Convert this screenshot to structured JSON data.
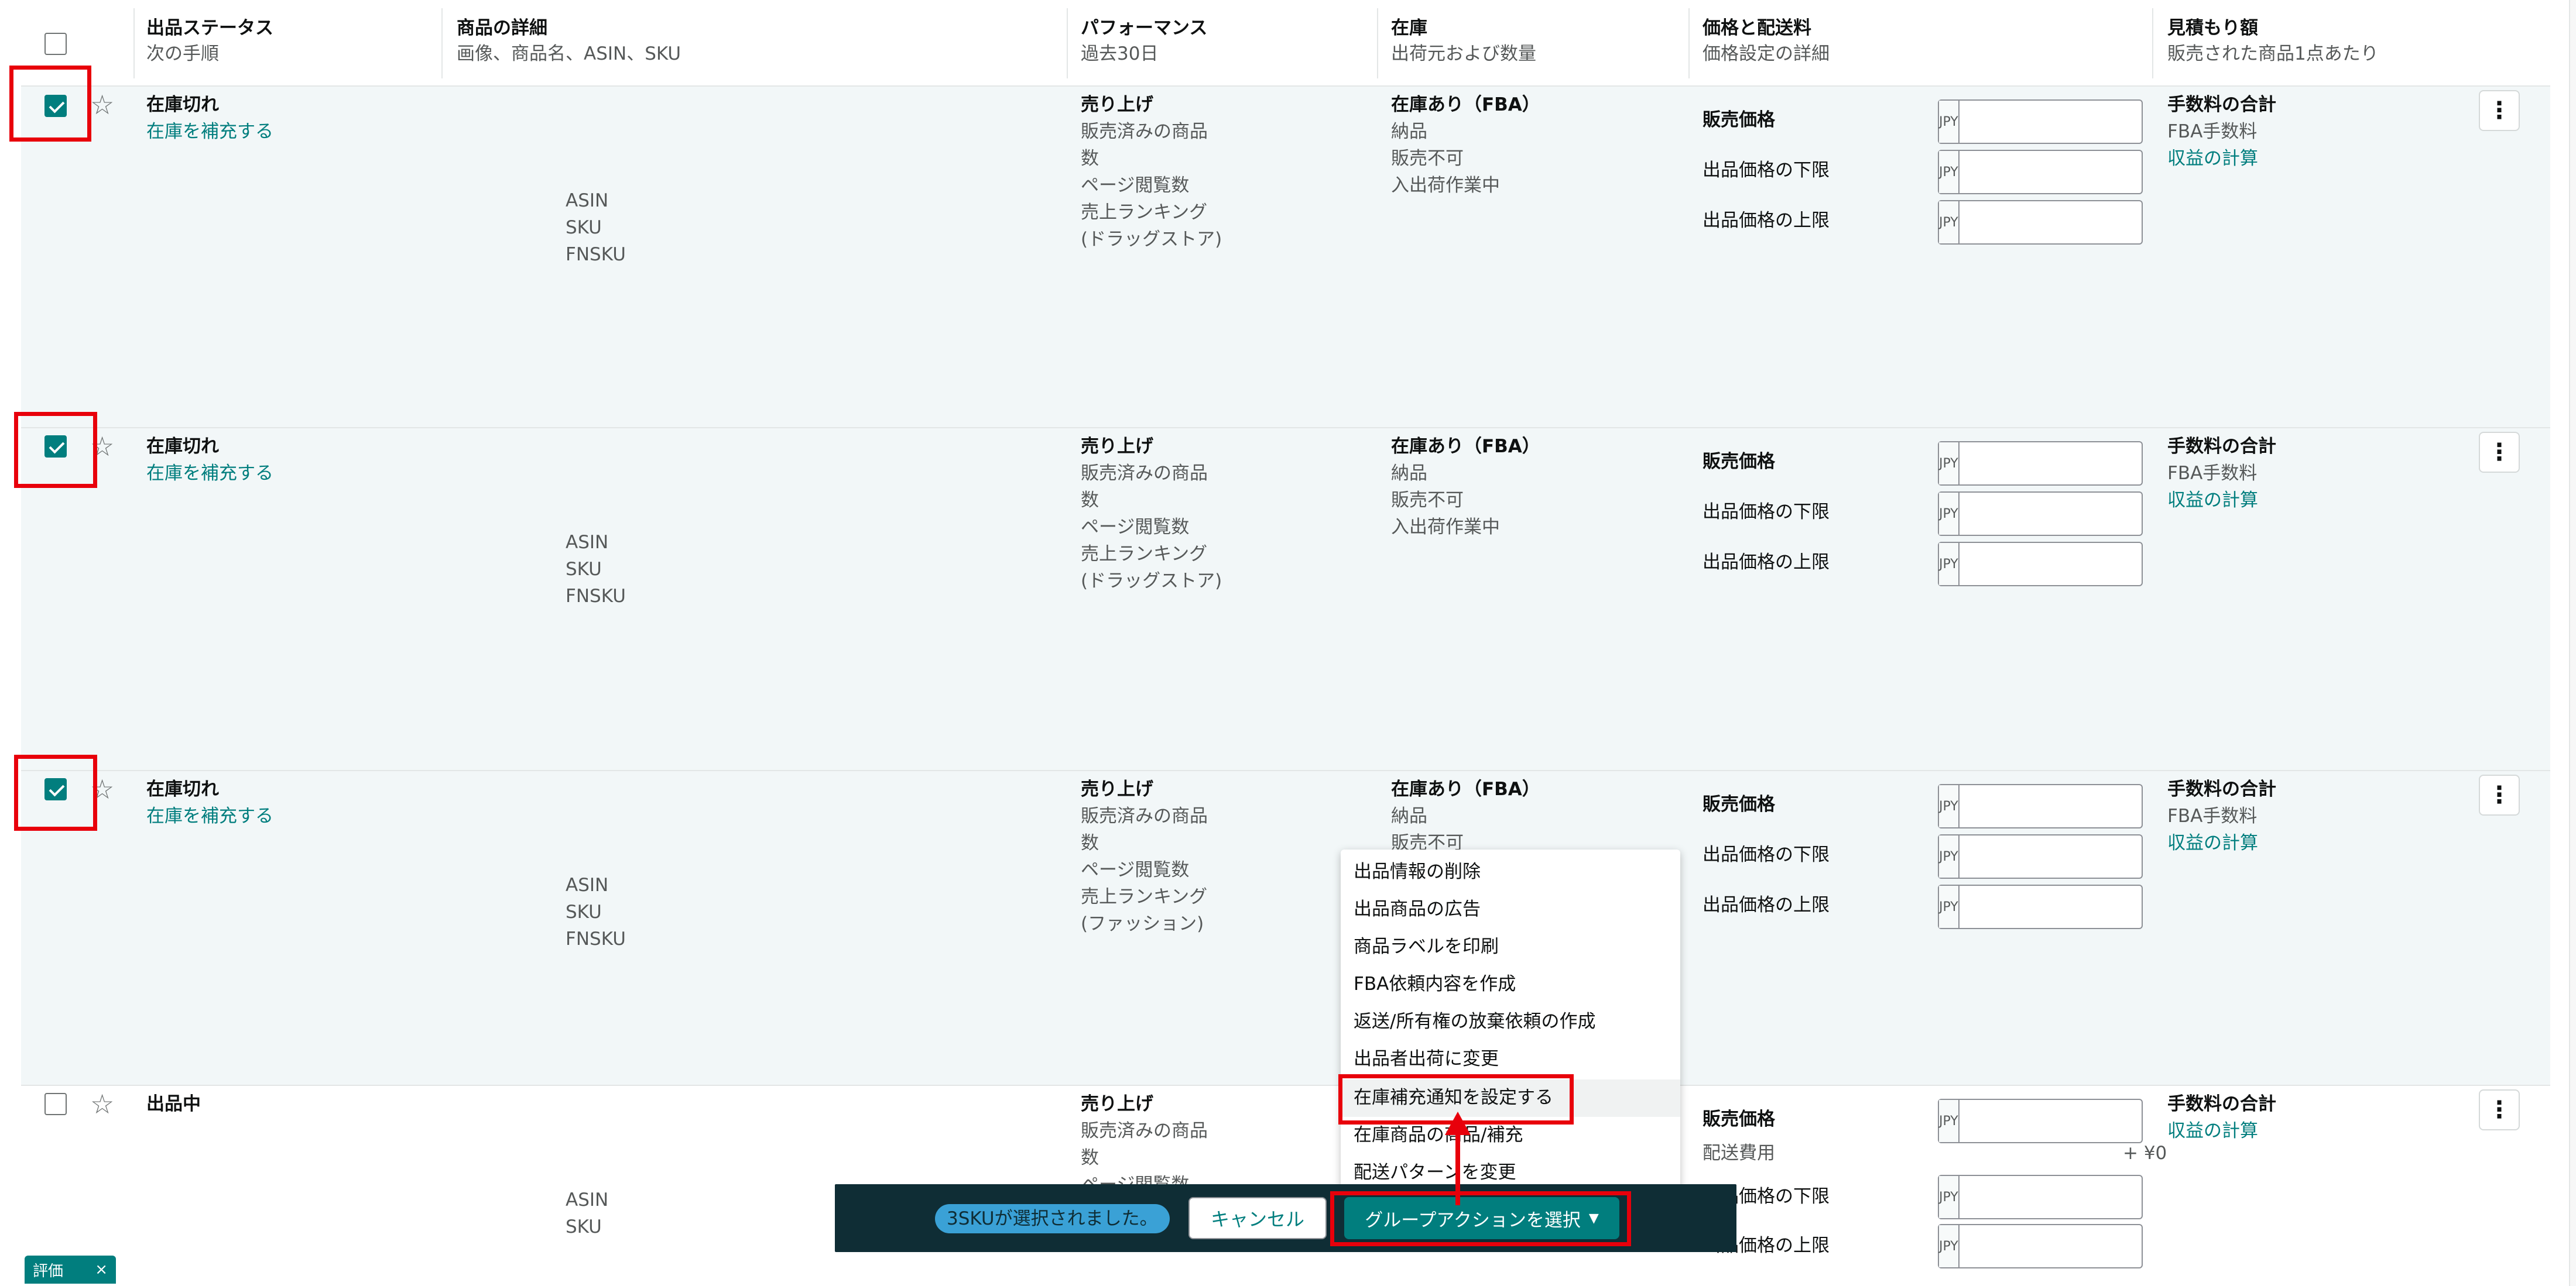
{
  "header": {
    "col_status": {
      "title": "出品ステータス",
      "sub": "次の手順"
    },
    "col_detail": {
      "title": "商品の詳細",
      "sub": "画像、商品名、ASIN、SKU"
    },
    "col_perf": {
      "title": "パフォーマンス",
      "sub": "過去30日"
    },
    "col_stock": {
      "title": "在庫",
      "sub": "出荷元および数量"
    },
    "col_price": {
      "title": "価格と配送料",
      "sub": "価格設定の詳細"
    },
    "col_est": {
      "title": "見積もり額",
      "sub": "販売された商品1点あたり"
    }
  },
  "rows": [
    {
      "status": "在庫切れ",
      "action": "在庫を補充する",
      "id_labels": [
        "ASIN",
        "SKU",
        "FNSKU"
      ],
      "perf": [
        "売り上げ",
        "販売済みの商品",
        "数",
        "ページ閲覧数",
        "売上ランキング",
        "(ドラッグストア)"
      ],
      "stock": [
        "在庫あり（FBA）",
        "納品",
        "販売不可",
        "入出荷作業中"
      ],
      "price_labels": [
        "販売価格",
        "出品価格の下限",
        "出品価格の上限"
      ],
      "currency": "JPY",
      "fees": [
        "手数料の合計",
        "FBA手数料",
        "収益の計算"
      ]
    },
    {
      "status": "在庫切れ",
      "action": "在庫を補充する",
      "id_labels": [
        "ASIN",
        "SKU",
        "FNSKU"
      ],
      "perf": [
        "売り上げ",
        "販売済みの商品",
        "数",
        "ページ閲覧数",
        "売上ランキング",
        "(ドラッグストア)"
      ],
      "stock": [
        "在庫あり（FBA）",
        "納品",
        "販売不可",
        "入出荷作業中"
      ],
      "price_labels": [
        "販売価格",
        "出品価格の下限",
        "出品価格の上限"
      ],
      "currency": "JPY",
      "fees": [
        "手数料の合計",
        "FBA手数料",
        "収益の計算"
      ]
    },
    {
      "status": "在庫切れ",
      "action": "在庫を補充する",
      "id_labels": [
        "ASIN",
        "SKU",
        "FNSKU"
      ],
      "perf": [
        "売り上げ",
        "販売済みの商品",
        "数",
        "ページ閲覧数",
        "売上ランキング",
        "(ファッション)"
      ],
      "stock": [
        "在庫あり（FBA）",
        "納品",
        "販売不可"
      ],
      "price_labels": [
        "販売価格",
        "出品価格の下限",
        "出品価格の上限"
      ],
      "currency": "JPY",
      "fees": [
        "手数料の合計",
        "FBA手数料",
        "収益の計算"
      ]
    },
    {
      "status": "出品中",
      "id_labels": [
        "ASIN",
        "SKU"
      ],
      "perf": [
        "売り上げ",
        "販売済みの商品",
        "数",
        "ページ閲覧数"
      ],
      "price_labels": [
        "販売価格",
        "配送費用",
        "出品価格の下限",
        "出品価格の上限"
      ],
      "shipping_value": "+ ¥0",
      "currency": "JPY",
      "fees": [
        "手数料の合計",
        "収益の計算"
      ]
    }
  ],
  "dropdown": {
    "items": [
      "出品情報の削除",
      "出品商品の広告",
      "商品ラベルを印刷",
      "FBA依頼内容を作成",
      "返送/所有権の放棄依頼の作成",
      "出品者出荷に変更",
      "在庫補充通知を設定する",
      "在庫商品の商品/補充",
      "配送パターンを変更"
    ]
  },
  "actionbar": {
    "selected_text": "3SKUが選択されました。",
    "cancel_label": "キャンセル",
    "group_label": "グループアクションを選択"
  },
  "eval_tab": {
    "label": "評価",
    "close": "×"
  },
  "colors": {
    "accent": "#017e7e",
    "highlight_red": "#e8000b",
    "bar_bg": "#0f2d35",
    "selected_row": "#f2f7f8"
  }
}
